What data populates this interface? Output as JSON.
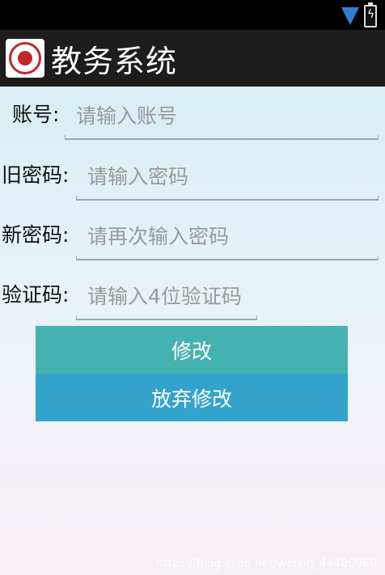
{
  "status_bar": {
    "icons": [
      "wifi-icon",
      "battery-charging-icon"
    ]
  },
  "app": {
    "title": "教务系统",
    "logo": "school-logo"
  },
  "form": {
    "account": {
      "label": "账号:",
      "placeholder": "请输入账号"
    },
    "old_password": {
      "label": "旧密码:",
      "placeholder": "请输入密码"
    },
    "new_password": {
      "label": "新密码:",
      "placeholder": "请再次输入密码"
    },
    "captcha": {
      "label": "验证码:",
      "placeholder": "请输入4位验证码"
    }
  },
  "buttons": {
    "modify": "修改",
    "cancel": "放弃修改"
  },
  "watermark": "https://blog.csdn.net/weixin_44480960",
  "colors": {
    "primary_button": "#44b2b0",
    "secondary_button": "#33a3cc",
    "action_bar": "#1d1d1d"
  }
}
